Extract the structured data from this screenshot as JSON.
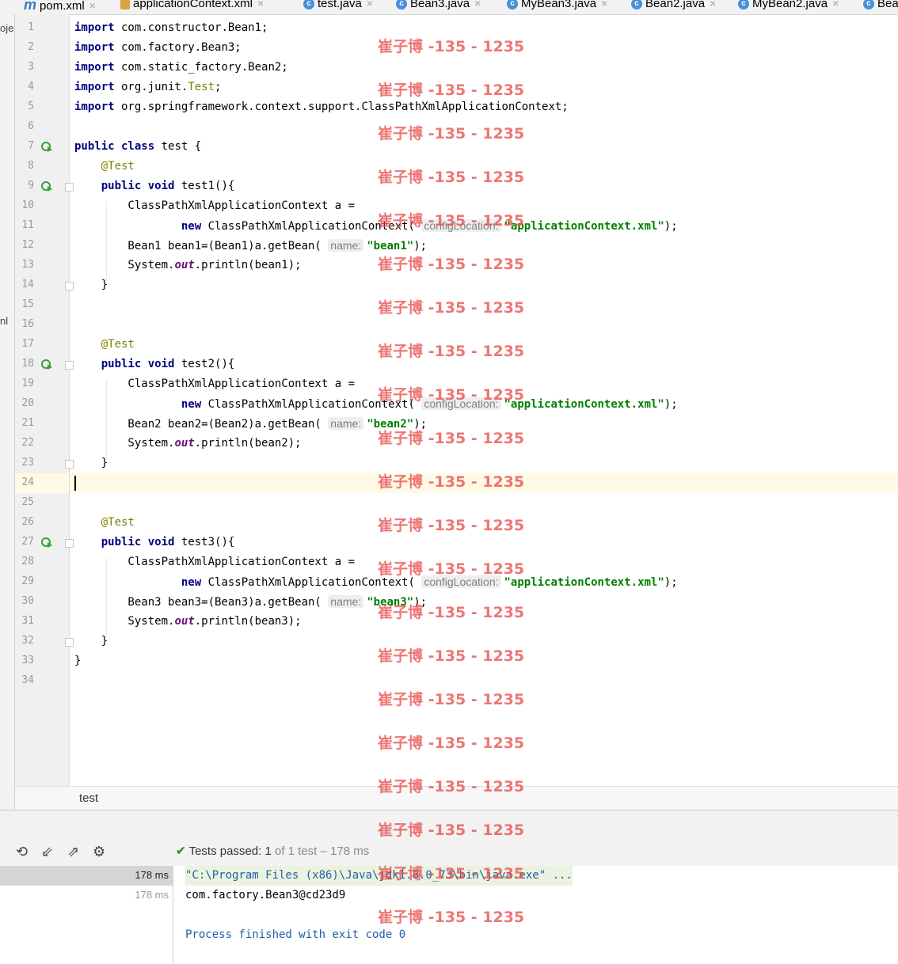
{
  "tabs": [
    {
      "label": "pom.xml",
      "icon": "maven-icon",
      "active": false
    },
    {
      "label": "applicationContext.xml",
      "icon": "xml-file-icon",
      "active": false
    },
    {
      "label": "test.java",
      "icon": "java-class-icon",
      "active": true
    },
    {
      "label": "Bean3.java",
      "icon": "java-class-icon",
      "active": false
    },
    {
      "label": "MyBean3.java",
      "icon": "java-class-icon",
      "active": false
    },
    {
      "label": "Bean2.java",
      "icon": "java-class-icon",
      "active": false
    },
    {
      "label": "MyBean2.java",
      "icon": "java-class-icon",
      "active": false
    },
    {
      "label": "Bea",
      "icon": "java-class-icon",
      "active": false
    }
  ],
  "left_strip": {
    "top_text": "oje",
    "mid_text": "nl"
  },
  "editor": {
    "current_line": 24,
    "run_gutter_lines": [
      7,
      9,
      18,
      27
    ],
    "lines": [
      [
        [
          "kw",
          "import"
        ],
        [
          "t",
          " com.constructor.Bean1;"
        ]
      ],
      [
        [
          "kw",
          "import"
        ],
        [
          "t",
          " com.factory.Bean3;"
        ]
      ],
      [
        [
          "kw",
          "import"
        ],
        [
          "t",
          " com.static_factory.Bean2;"
        ]
      ],
      [
        [
          "kw",
          "import"
        ],
        [
          "t",
          " org.junit."
        ],
        [
          "ann",
          "Test"
        ],
        [
          "t",
          ";"
        ]
      ],
      [
        [
          "kw",
          "import"
        ],
        [
          "t",
          " org.springframework.context.support.ClassPathXmlApplicationContext;"
        ]
      ],
      [],
      [
        [
          "kw",
          "public class"
        ],
        [
          "t",
          " test {"
        ]
      ],
      [
        [
          "t",
          "    "
        ],
        [
          "ann",
          "@Test"
        ]
      ],
      [
        [
          "t",
          "    "
        ],
        [
          "kw",
          "public void"
        ],
        [
          "t",
          " test1(){"
        ]
      ],
      [
        [
          "t",
          "        ClassPathXmlApplicationContext a ="
        ]
      ],
      [
        [
          "t",
          "                "
        ],
        [
          "kw",
          "new"
        ],
        [
          "t",
          " ClassPathXmlApplicationContext( "
        ],
        [
          "hint",
          "configLocation:"
        ],
        [
          "str",
          "\"applicationContext.xml\""
        ],
        [
          "t",
          ");"
        ]
      ],
      [
        [
          "t",
          "        Bean1 bean1=(Bean1)a.getBean( "
        ],
        [
          "hint",
          "name:"
        ],
        [
          "str",
          "\"bean1\""
        ],
        [
          "t",
          ");"
        ]
      ],
      [
        [
          "t",
          "        System."
        ],
        [
          "fld",
          "out"
        ],
        [
          "t",
          ".println(bean1);"
        ]
      ],
      [
        [
          "t",
          "    }"
        ]
      ],
      [],
      [],
      [
        [
          "t",
          "    "
        ],
        [
          "ann",
          "@Test"
        ]
      ],
      [
        [
          "t",
          "    "
        ],
        [
          "kw",
          "public void"
        ],
        [
          "t",
          " test2(){"
        ]
      ],
      [
        [
          "t",
          "        ClassPathXmlApplicationContext a ="
        ]
      ],
      [
        [
          "t",
          "                "
        ],
        [
          "kw",
          "new"
        ],
        [
          "t",
          " ClassPathXmlApplicationContext( "
        ],
        [
          "hint",
          "configLocation:"
        ],
        [
          "str",
          "\"applicationContext.xml\""
        ],
        [
          "t",
          ");"
        ]
      ],
      [
        [
          "t",
          "        Bean2 bean2=(Bean2)a.getBean( "
        ],
        [
          "hint",
          "name:"
        ],
        [
          "str",
          "\"bean2\""
        ],
        [
          "t",
          ");"
        ]
      ],
      [
        [
          "t",
          "        System."
        ],
        [
          "fld",
          "out"
        ],
        [
          "t",
          ".println(bean2);"
        ]
      ],
      [
        [
          "t",
          "    }"
        ]
      ],
      [],
      [],
      [
        [
          "t",
          "    "
        ],
        [
          "ann",
          "@Test"
        ]
      ],
      [
        [
          "t",
          "    "
        ],
        [
          "kw",
          "public void"
        ],
        [
          "t",
          " test3(){"
        ]
      ],
      [
        [
          "t",
          "        ClassPathXmlApplicationContext a ="
        ]
      ],
      [
        [
          "t",
          "                "
        ],
        [
          "kw",
          "new"
        ],
        [
          "t",
          " ClassPathXmlApplicationContext( "
        ],
        [
          "hint",
          "configLocation:"
        ],
        [
          "str",
          "\"applicationContext.xml\""
        ],
        [
          "t",
          ");"
        ]
      ],
      [
        [
          "t",
          "        Bean3 bean3=(Bean3)a.getBean( "
        ],
        [
          "hint",
          "name:"
        ],
        [
          "str",
          "\"bean3\""
        ],
        [
          "t",
          ");"
        ]
      ],
      [
        [
          "t",
          "        System."
        ],
        [
          "fld",
          "out"
        ],
        [
          "t",
          ".println(bean3);"
        ]
      ],
      [
        [
          "t",
          "    }"
        ]
      ],
      [
        [
          "t",
          "}"
        ]
      ],
      []
    ]
  },
  "breadcrumb": {
    "item": "test"
  },
  "run_panel": {
    "toolbar_icons": [
      "history-icon",
      "import-tests-icon",
      "export-tests-icon",
      "settings-icon"
    ],
    "status": {
      "prefix": "Tests passed:",
      "count": "1",
      "suffix": "of 1 test – 178 ms"
    },
    "tree_rows": [
      {
        "time": "178 ms",
        "selected": true
      },
      {
        "time": "178 ms",
        "selected": false
      }
    ],
    "console": [
      {
        "text": "\"C:\\Program Files (x86)\\Java\\jdk1.8.0_73\\bin\\java.exe\" ...",
        "color": "#1f5fa8",
        "bg": "#ebf3e0"
      },
      {
        "text": "com.factory.Bean3@cd23d9",
        "color": "#000000",
        "bg": ""
      },
      {
        "text": "",
        "color": "#000000",
        "bg": ""
      },
      {
        "text": "Process finished with exit code 0",
        "color": "#1f5fa8",
        "bg": ""
      }
    ]
  },
  "watermark": {
    "text": "崔子博 -135 - 1235"
  }
}
